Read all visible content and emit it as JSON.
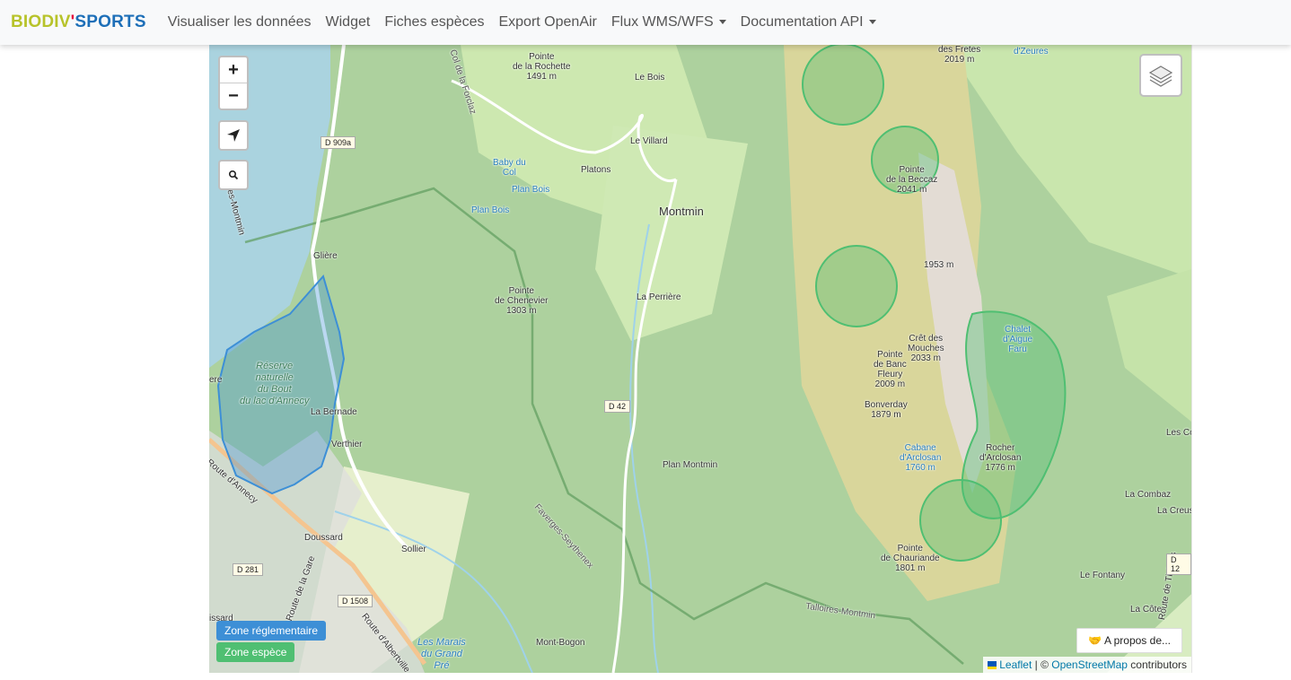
{
  "brand": {
    "part1": "BIODIV",
    "part2": "'",
    "part3": "SPORTS"
  },
  "nav": {
    "items": [
      {
        "label": "Visualiser les données",
        "dropdown": false
      },
      {
        "label": "Widget",
        "dropdown": false
      },
      {
        "label": "Fiches espèces",
        "dropdown": false
      },
      {
        "label": "Export OpenAir",
        "dropdown": false
      },
      {
        "label": "Flux WMS/WFS",
        "dropdown": true
      },
      {
        "label": "Documentation API",
        "dropdown": true
      }
    ]
  },
  "map": {
    "controls": {
      "zoom_in": "+",
      "zoom_out": "−"
    },
    "legend": {
      "zone_reglementaire": "Zone réglementaire",
      "zone_espece": "Zone espèce",
      "colors": {
        "zone_reglementaire": "#3d8fd6",
        "zone_espece": "#4fbf72"
      }
    },
    "about": "A propos de...",
    "attribution": {
      "leaflet": "Leaflet",
      "sep": " | © ",
      "osm": "OpenStreetMap",
      "contributors": " contributors"
    },
    "labels": {
      "pointe_rochette": "Pointe\nde la Rochette\n1491 m",
      "le_bois": "Le Bois",
      "le_villard": "Le Villard",
      "baby_du_col": "Baby du\nCol",
      "plan_bois_1": "Plan Bois",
      "plan_bois_2": "Plan Bois",
      "platons": "Platons",
      "montmin": "Montmin",
      "gliere": "Glière",
      "pointe_chenevier": "Pointe\nde Chenevier\n1303 m",
      "la_perriere": "La Perrière",
      "reserve": "Réserve\nnaturelle\ndu Bout\ndu lac d'Annecy",
      "la_bernade": "La Bernade",
      "verthier": "Verthier",
      "plan_montmin": "Plan Montmin",
      "doussard": "Doussard",
      "sollier": "Sollier",
      "mont_bogon": "Mont-Bogon",
      "les_marais": "Les Marais\ndu Grand\nPré",
      "pointe_beccaz": "Pointe\nde la Beccaz\n2041 m",
      "m1953": "1953 m",
      "cret_mouches": "Crêt des\nMouches\n2033 m",
      "pointe_banc": "Pointe\nde Banc\nFleury\n2009 m",
      "bonverday": "Bonverday\n1879 m",
      "cabane_arclosan": "Cabane\nd'Arclosan\n1760 m",
      "chalet_aigue": "Chalet\nd'Aigue\nFaru",
      "rocher_arclosan": "Rocher\nd'Arclosan\n1776 m",
      "pointe_chauriande": "Pointe\nde Chauriande\n1801 m",
      "la_combaz": "La Combaz",
      "la_creus": "La Creus",
      "les_co": "Les Co",
      "le_fontany": "Le Fontany",
      "la_cote": "La Côte",
      "des_fretes": "des Fretes\n2019 m",
      "dzeures": "d'Zeures",
      "col_forclaz": "Col de la Forclaz",
      "faverges": "Faverges-Seythenex",
      "talloires": "Talloires-Montmin",
      "route_annecy": "Route d'Annecy",
      "route_gare": "Route de la Gare",
      "route_albertville": "Route d'Albertville",
      "les_montmin": "es-Montmin",
      "route_thones": "Route de Thônes",
      "issard": "issard",
      "ere": "ere"
    },
    "roads": {
      "d909a": "D 909a",
      "d42": "D 42",
      "d281": "D 281",
      "d1508": "D 1508",
      "d12": "D 12"
    }
  }
}
